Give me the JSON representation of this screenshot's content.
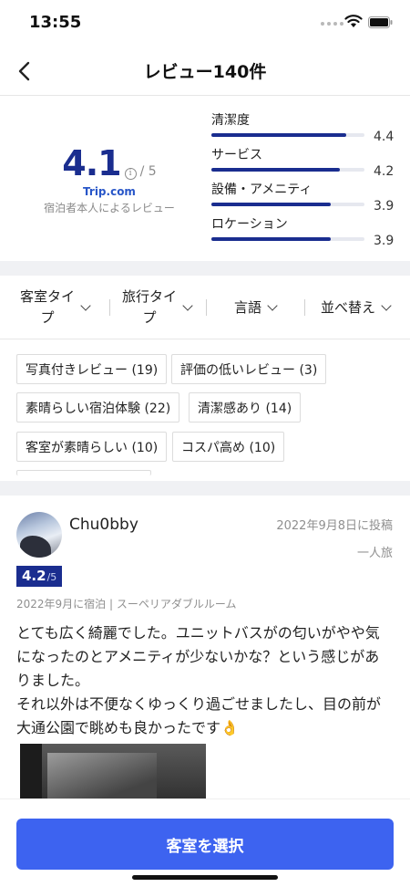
{
  "status_bar": {
    "time": "13:55"
  },
  "header": {
    "title": "レビュー140件"
  },
  "summary": {
    "score": "4.1",
    "info_glyph": "i",
    "max": "/ 5",
    "provider": "Trip.com",
    "verified": "宿泊者本人によるレビュー",
    "categories": [
      {
        "label": "清潔度",
        "value": "4.4",
        "fraction": 0.88
      },
      {
        "label": "サービス",
        "value": "4.2",
        "fraction": 0.84
      },
      {
        "label": "設備・アメニティ",
        "value": "3.9",
        "fraction": 0.78
      },
      {
        "label": "ロケーション",
        "value": "3.9",
        "fraction": 0.78
      }
    ]
  },
  "filters": [
    {
      "line1": "客室タイ",
      "line2": "プ"
    },
    {
      "line1": "旅行タイ",
      "line2": "プ"
    },
    {
      "line1": "言語",
      "line2": ""
    },
    {
      "line1": "並べ替え",
      "line2": ""
    }
  ],
  "chips": [
    "写真付きレビュー (19)",
    "評価の低いレビュー (3)",
    "素晴らしい宿泊体験 (22)",
    "清潔感あり (14)",
    "客室が素晴らしい (10)",
    "コスパ高め (10)"
  ],
  "review": {
    "name": "Chu0bby",
    "date": "2022年9月8日に投稿",
    "trip_type": "一人旅",
    "rating": "4.2",
    "rating_max": "/5",
    "stay": "2022年9月に宿泊 | スーペリアダブルルーム",
    "text_line1": "とても広く綺麗でした。ユニットバスがの匂いがやや気になったのとアメニティが少ないかな？という感じがありました。",
    "text_line2": "それ以外は不便なくゆっくり過ごせましたし、目の前が大通公園で眺めも良かったです👌"
  },
  "cta": {
    "label": "客室を選択"
  },
  "colors": {
    "accent": "#1a2d8f",
    "button": "#3d63f0",
    "provider": "#2856c8"
  }
}
